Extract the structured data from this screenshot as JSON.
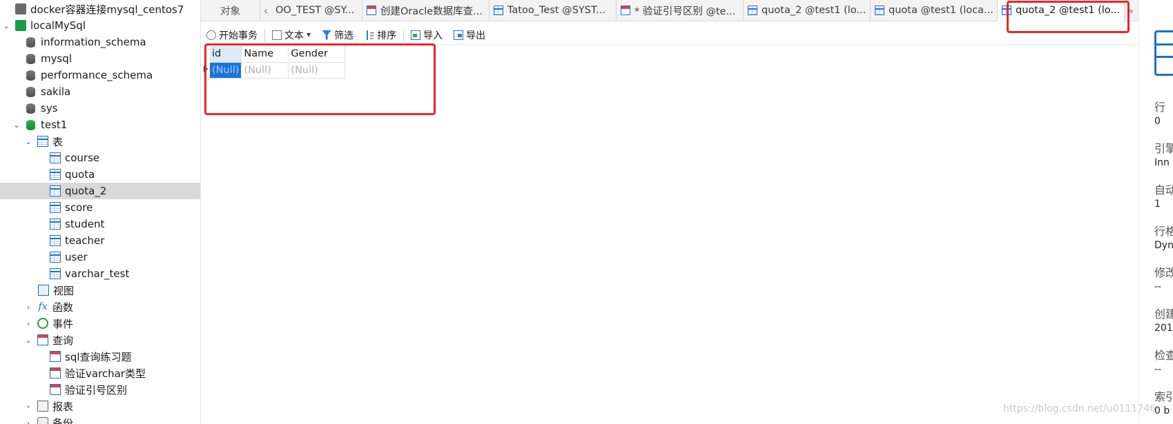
{
  "sidebar": {
    "items": [
      {
        "label": "docker容器连接mysql_centos7",
        "icon": "connection-gray-icon",
        "caret": ""
      },
      {
        "label": "localMySql",
        "icon": "connection-green-icon",
        "caret": "v"
      },
      {
        "label": "information_schema",
        "icon": "database-icon",
        "caret": ""
      },
      {
        "label": "mysql",
        "icon": "database-icon",
        "caret": ""
      },
      {
        "label": "performance_schema",
        "icon": "database-icon",
        "caret": ""
      },
      {
        "label": "sakila",
        "icon": "database-icon",
        "caret": ""
      },
      {
        "label": "sys",
        "icon": "database-icon",
        "caret": ""
      },
      {
        "label": "test1",
        "icon": "database-open-icon",
        "caret": "v"
      },
      {
        "label": "表",
        "icon": "tables-folder-icon",
        "caret": "v"
      },
      {
        "label": "course",
        "icon": "table-icon",
        "caret": ""
      },
      {
        "label": "quota",
        "icon": "table-icon",
        "caret": ""
      },
      {
        "label": "quota_2",
        "icon": "table-icon",
        "caret": "",
        "selected": true
      },
      {
        "label": "score",
        "icon": "table-icon",
        "caret": ""
      },
      {
        "label": "student",
        "icon": "table-icon",
        "caret": ""
      },
      {
        "label": "teacher",
        "icon": "table-icon",
        "caret": ""
      },
      {
        "label": "user",
        "icon": "table-icon",
        "caret": ""
      },
      {
        "label": "varchar_test",
        "icon": "table-icon",
        "caret": ""
      },
      {
        "label": "视图",
        "icon": "views-folder-icon",
        "caret": ""
      },
      {
        "label": "函数",
        "icon": "function-icon",
        "caret": ">"
      },
      {
        "label": "事件",
        "icon": "event-icon",
        "caret": ">"
      },
      {
        "label": "查询",
        "icon": "queries-folder-icon",
        "caret": "v"
      },
      {
        "label": "sql查询练习题",
        "icon": "query-icon",
        "caret": ""
      },
      {
        "label": "验证varchar类型",
        "icon": "query-icon",
        "caret": ""
      },
      {
        "label": "验证引号区别",
        "icon": "query-icon",
        "caret": ""
      },
      {
        "label": "报表",
        "icon": "reports-folder-icon",
        "caret": ">"
      },
      {
        "label": "备份",
        "icon": "backup-icon",
        "caret": ">"
      }
    ]
  },
  "tabs": {
    "objects_label": "对象",
    "prev_icon": "‹",
    "next_icon": "»",
    "items": [
      {
        "label": "OO_TEST @SY...",
        "icon": "",
        "active": false
      },
      {
        "label": "创建Oracle数据库查...",
        "icon": "query-icon",
        "active": false
      },
      {
        "label": "Tatoo_Test @SYST...",
        "icon": "table-icon",
        "active": false
      },
      {
        "label": "* 验证引号区别 @te...",
        "icon": "query-icon",
        "active": false
      },
      {
        "label": "quota_2 @test1 (lo...",
        "icon": "table-icon",
        "active": false
      },
      {
        "label": "quota @test1 (loca...",
        "icon": "table-icon",
        "active": false
      },
      {
        "label": "quota_2 @test1 (lo...",
        "icon": "table-icon",
        "active": true
      }
    ]
  },
  "toolbar": {
    "begin_transaction": "开始事务",
    "text": "文本",
    "filter": "筛选",
    "sort": "排序",
    "import": "导入",
    "export": "导出"
  },
  "grid": {
    "columns": [
      "id",
      "Name",
      "Gender"
    ],
    "rows": [
      [
        "(Null)",
        "(Null)",
        "(Null)"
      ]
    ]
  },
  "info_panel": {
    "fields": [
      {
        "label": "行",
        "value": "0"
      },
      {
        "label": "引擎",
        "value": "Inn"
      },
      {
        "label": "自动",
        "value": "1"
      },
      {
        "label": "行格",
        "value": "Dyn"
      },
      {
        "label": "修改",
        "value": "--"
      },
      {
        "label": "创建",
        "value": "201"
      },
      {
        "label": "检查",
        "value": "--"
      },
      {
        "label": "索引",
        "value": "0 b"
      }
    ]
  },
  "watermark": "https://blog.csdn.net/u0111746",
  "colors": {
    "highlight": "#e8262a",
    "selected_cell": "#1a73d9",
    "accent": "#1f6fc4"
  }
}
